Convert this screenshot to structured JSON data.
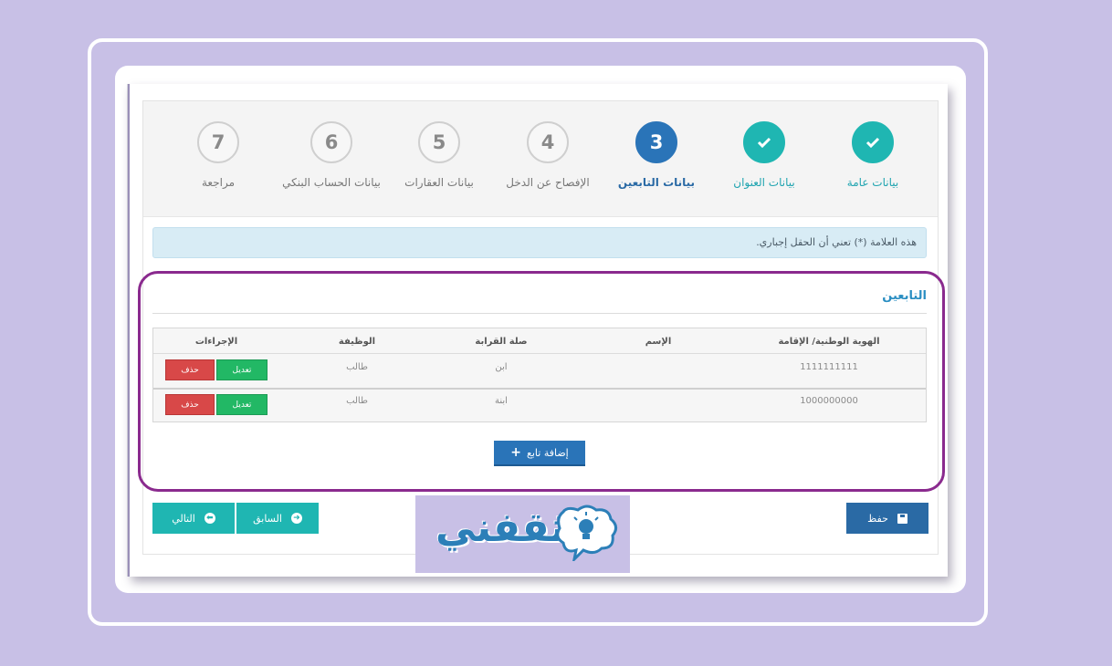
{
  "steps": [
    {
      "number": "7",
      "label": "مراجعة",
      "state": "pending"
    },
    {
      "number": "6",
      "label": "بيانات الحساب البنكي",
      "state": "pending"
    },
    {
      "number": "5",
      "label": "بيانات العقارات",
      "state": "pending"
    },
    {
      "number": "4",
      "label": "الإفصاح عن الدخل",
      "state": "pending"
    },
    {
      "number": "3",
      "label": "بيانات التابعين",
      "state": "active"
    },
    {
      "number": "",
      "label": "بيانات العنوان",
      "state": "done",
      "icon": "check-icon"
    },
    {
      "number": "",
      "label": "بيانات عامة",
      "state": "done",
      "icon": "check-icon"
    }
  ],
  "alert_text": "هذه العلامة (*) تعني أن الحقل إجباري.",
  "section_title": "التابعين",
  "table": {
    "headers": [
      "الهوية الوطنية/ الإقامة",
      "الإسم",
      "صلة القرابة",
      "الوظيفة",
      "الإجراءات"
    ],
    "rows": [
      {
        "id": "1111111111",
        "name": "",
        "relation": "ابن",
        "job": "طالب",
        "edit": "تعديل",
        "delete": "حذف"
      },
      {
        "id": "1000000000",
        "name": "",
        "relation": "ابنة",
        "job": "طالب",
        "edit": "تعديل",
        "delete": "حذف"
      }
    ]
  },
  "buttons": {
    "add_dependent": "إضافة تابع",
    "save": "حفظ",
    "previous": "السابق",
    "next": "التالي"
  },
  "logo_text": "ثقفني",
  "colors": {
    "teal": "#1fb6b2",
    "blue": "#2a74b8",
    "highlight": "#8a2a8e",
    "edit_green": "#22b865",
    "delete_red": "#d84848",
    "background": "#c8c0e6"
  }
}
